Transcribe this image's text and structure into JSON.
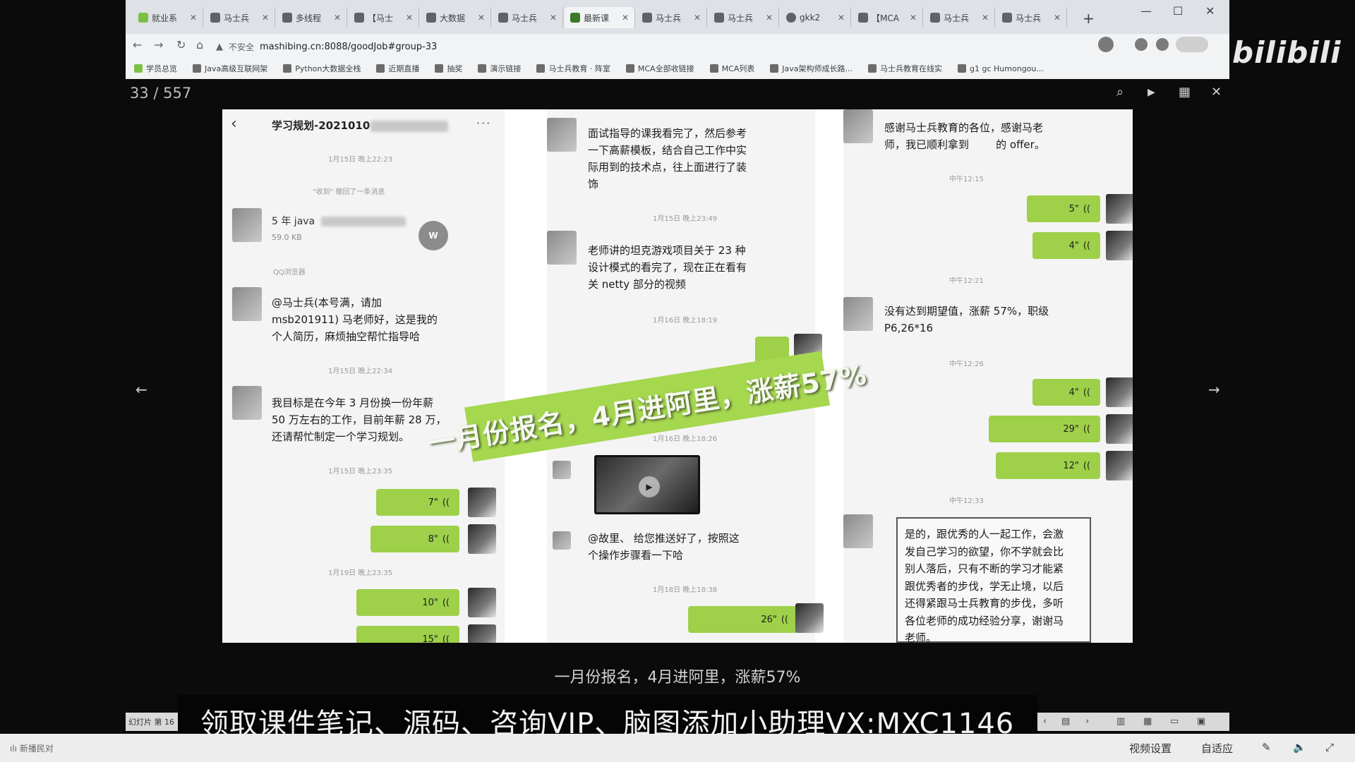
{
  "browser": {
    "tabs": [
      {
        "label": "就业系"
      },
      {
        "label": "马士兵"
      },
      {
        "label": "多线程"
      },
      {
        "label": "【马士"
      },
      {
        "label": "大数据"
      },
      {
        "label": "马士兵"
      },
      {
        "label": "最新课"
      },
      {
        "label": "马士兵"
      },
      {
        "label": "马士兵"
      },
      {
        "label": "gkk2"
      },
      {
        "label": "【MCA"
      },
      {
        "label": "马士兵"
      },
      {
        "label": "马士兵"
      }
    ],
    "new_tab": "+",
    "url_insecure": "不安全",
    "url": "mashibing.cn:8088/goodJob#group-33",
    "bookmarks": [
      "学员总览",
      "Java高级互联网架",
      "Python大数据全栈",
      "近期直播",
      "抽奖",
      "演示链接",
      "马士兵教育 · 阵室",
      "MCA全部收链接",
      "MCA列表",
      "Java架构师成长路...",
      "马士兵教育在线实",
      "g1 gc Humongou..."
    ]
  },
  "logo": "bilibili",
  "viewer": {
    "page_counter": "33 / 557"
  },
  "chat": {
    "header": "学习规划-2021010",
    "col1": {
      "ts1": "1月15日 晚上22:23",
      "sys": "\"收到\"  撤回了一条消息",
      "file_name": "5 年 java",
      "file_size": "59.0 KB",
      "file_icon": "W",
      "qq_label": "QQ浏览器",
      "msg1": "@马士兵(本号满，请加\nmsb201911) 马老师好，这是我的\n个人简历，麻烦抽空帮忙指导哈",
      "ts2": "1月15日 晚上22:34",
      "msg2": "我目标是在今年 3 月份换一份年薪\n50 万左右的工作，目前年薪 28 万，\n还请帮忙制定一个学习规划。",
      "ts3": "1月15日 晚上23:35",
      "voice1": "7\"",
      "voice2": "8\"",
      "ts4": "1月19日 晚上23:35",
      "voice3": "10\"",
      "voice4": "15\""
    },
    "col2": {
      "msg1": "面试指导的课我看完了，然后参考\n一下高薪模板，结合自己工作中实\n际用到的技术点，往上面进行了装\n饰",
      "ts1": "1月15日 晚上23:49",
      "msg2": "老师讲的坦克游戏项目关于 23 种\n设计模式的看完了，现在正在看有\n关 netty 部分的视频",
      "ts2": "1月16日 晚上18:19",
      "ts3": "1月16日 晚上18:26",
      "msg3": "@故里、 给您推送好了，按照这\n个操作步骤看一下哈",
      "ts4": "1月18日 晚上18:38",
      "voice1": "26\""
    },
    "col3": {
      "msg1": "感谢马士兵教育的各位，感谢马老\n师，我已顺利拿到        的 offer。",
      "ts1": "中午12:15",
      "voice1": "5\"",
      "voice2": "4\"",
      "ts2": "中午12:21",
      "msg2": "没有达到期望值，涨薪 57%，职级\nP6,26*16",
      "ts3": "中午12:26",
      "voice3": "4\"",
      "voice4": "29\"",
      "voice5": "12\"",
      "ts4": "中午12:33",
      "quote": "是的，跟优秀的人一起工作，会激\n发自己学习的欲望，你不学就会比\n别人落后，只有不断的学习才能紧\n跟优秀者的步伐，学无止境，以后\n还得紧跟马士兵教育的步伐，多听\n各位老师的成功经验分享，谢谢马\n老师。"
    }
  },
  "banner": "一月份报名，4月进阿里，涨薪57%",
  "caption": "一月份报名，4月进阿里，涨薪57%",
  "ppt": {
    "slide_label": "幻灯片 第 16"
  },
  "promo": "领取课件笔记、源码、咨询VIP、脑图添加小助理VX:MXC1146",
  "footer": {
    "left": "ılı 新播民对",
    "settings": "视频设置",
    "fit": "自适应"
  },
  "colors": {
    "voice_bubble": "#9ed04a",
    "banner": "#a5d74f"
  }
}
